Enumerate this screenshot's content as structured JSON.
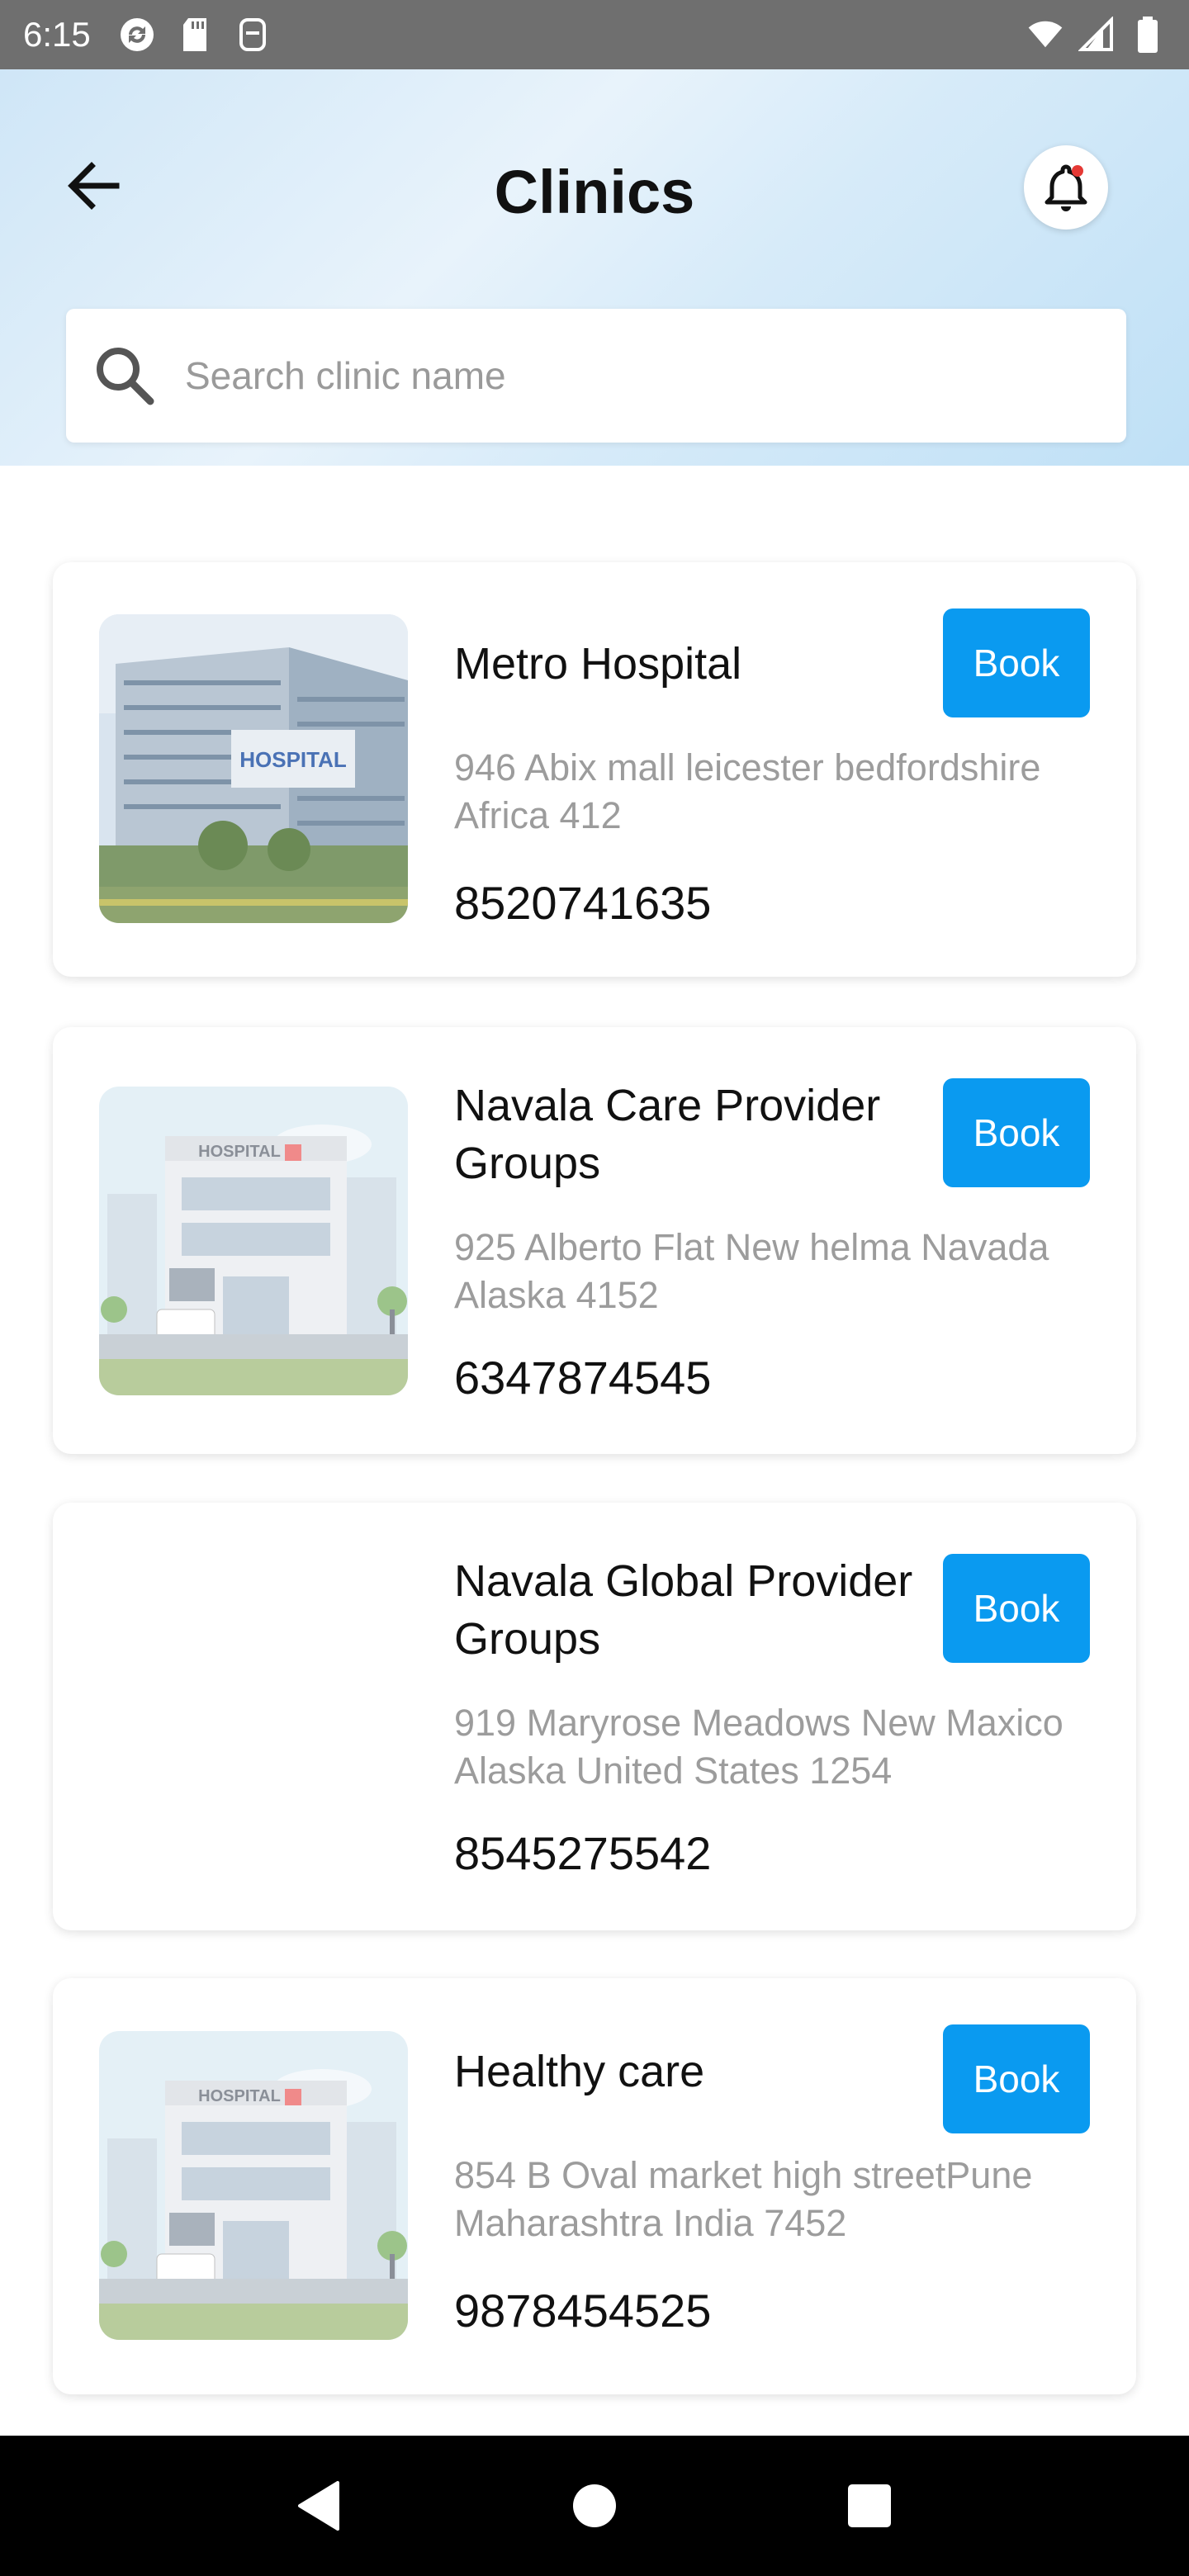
{
  "status_bar": {
    "time": "6:15"
  },
  "header": {
    "title": "Clinics"
  },
  "search": {
    "placeholder": "Search clinic name",
    "value": ""
  },
  "clinics": [
    {
      "name": "Metro  Hospital",
      "address": "946 Abix mall leicester bedfordshire Africa 412",
      "phone": "8520741635",
      "book_label": "Book",
      "image": "hospital-photo"
    },
    {
      "name": "Navala Care Provider Groups",
      "address": "925 Alberto Flat New helma Navada Alaska 4152",
      "phone": "6347874545",
      "book_label": "Book",
      "image": "hospital-illustration"
    },
    {
      "name": "Navala Global Provider Groups",
      "address": "919 Maryrose Meadows New Maxico Alaska United States 1254",
      "phone": "8545275542",
      "book_label": "Book",
      "image": "none"
    },
    {
      "name": "Healthy care",
      "address": "854 B Oval market high streetPune Maharashtra India 7452",
      "phone": "9878454525",
      "book_label": "Book",
      "image": "hospital-illustration"
    }
  ],
  "image_text": {
    "photo_sign": "HOSPITAL",
    "illustration_sign": "HOSPITAL"
  },
  "colors": {
    "accent": "#0a9af0",
    "status_bar": "#6f6f6f",
    "nav_bar": "#000000"
  }
}
